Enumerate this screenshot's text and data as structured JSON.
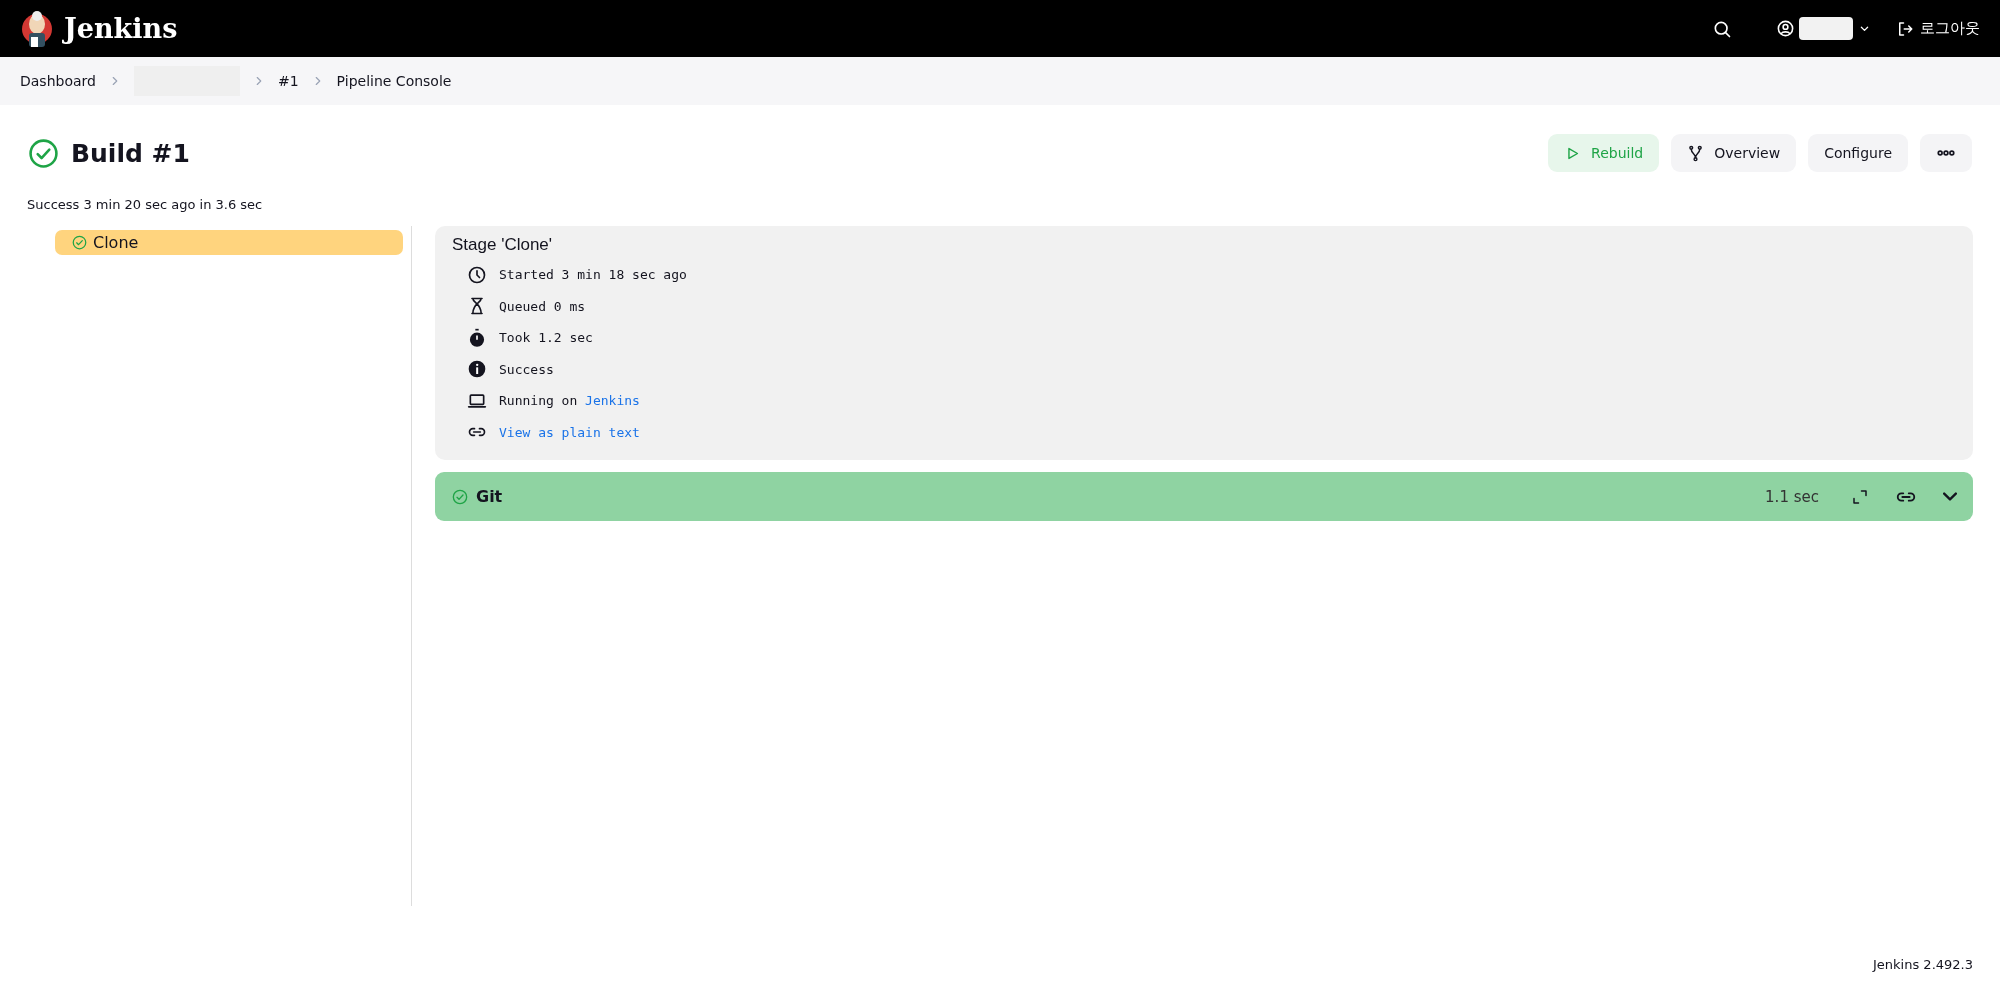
{
  "header": {
    "brand": "Jenkins",
    "logout": "로그아웃"
  },
  "breadcrumbs": [
    {
      "kind": "link",
      "label": "Dashboard"
    },
    {
      "kind": "redacted"
    },
    {
      "kind": "link",
      "label": "#1"
    },
    {
      "kind": "link",
      "label": "Pipeline Console"
    }
  ],
  "build": {
    "title": "Build #1",
    "kind": "success",
    "summary": "Success 3 min 20 sec ago in 3.6 sec"
  },
  "actions": [
    {
      "kind": "rebuild",
      "label": "Rebuild"
    },
    {
      "kind": "overview",
      "label": "Overview"
    },
    {
      "kind": "plain",
      "label": "Configure"
    },
    {
      "kind": "more"
    }
  ],
  "stages": [
    {
      "label": "Clone",
      "kind": "success",
      "selected": true
    }
  ],
  "stage_detail": {
    "title": "Stage 'Clone'",
    "rows": [
      {
        "kind": "clock",
        "text": "Started 3 min 18 sec ago"
      },
      {
        "kind": "hourglass",
        "text": "Queued 0 ms"
      },
      {
        "kind": "stopwatch",
        "text": "Took 1.2 sec"
      },
      {
        "kind": "info",
        "text": "Success"
      },
      {
        "kind": "computer",
        "text": "Running on",
        "link": "Jenkins"
      },
      {
        "kind": "link",
        "link": "View as plain text"
      }
    ]
  },
  "steps": [
    {
      "label": "Git",
      "kind": "success",
      "duration": "1.1 sec",
      "expanded": false
    }
  ],
  "footer": {
    "version": "Jenkins 2.492.3"
  }
}
